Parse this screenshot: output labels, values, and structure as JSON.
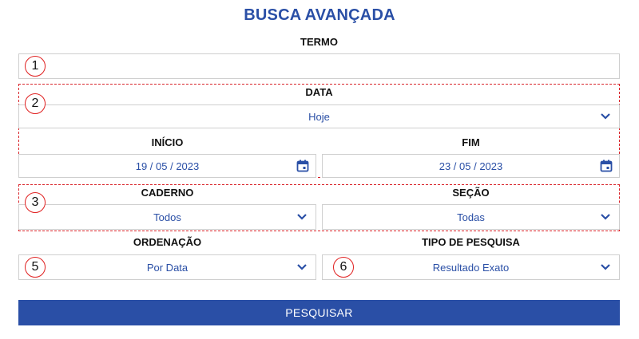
{
  "title": "BUSCA AVANÇADA",
  "termo": {
    "label": "TERMO",
    "value": ""
  },
  "data": {
    "label": "DATA",
    "value": "Hoje"
  },
  "inicio": {
    "label": "INÍCIO",
    "value": "19 / 05 / 2023"
  },
  "fim": {
    "label": "FIM",
    "value": "23 / 05 / 2023"
  },
  "caderno": {
    "label": "CADERNO",
    "value": "Todos"
  },
  "secao": {
    "label": "SEÇÃO",
    "value": "Todas"
  },
  "ordenacao": {
    "label": "ORDENAÇÃO",
    "value": "Por Data"
  },
  "tipo": {
    "label": "TIPO DE PESQUISA",
    "value": "Resultado Exato"
  },
  "submit_label": "PESQUISAR",
  "badges": [
    "1",
    "2",
    "3",
    "5",
    "6"
  ],
  "colors": {
    "accent": "#2a4fa6",
    "annotation": "#e02020"
  }
}
